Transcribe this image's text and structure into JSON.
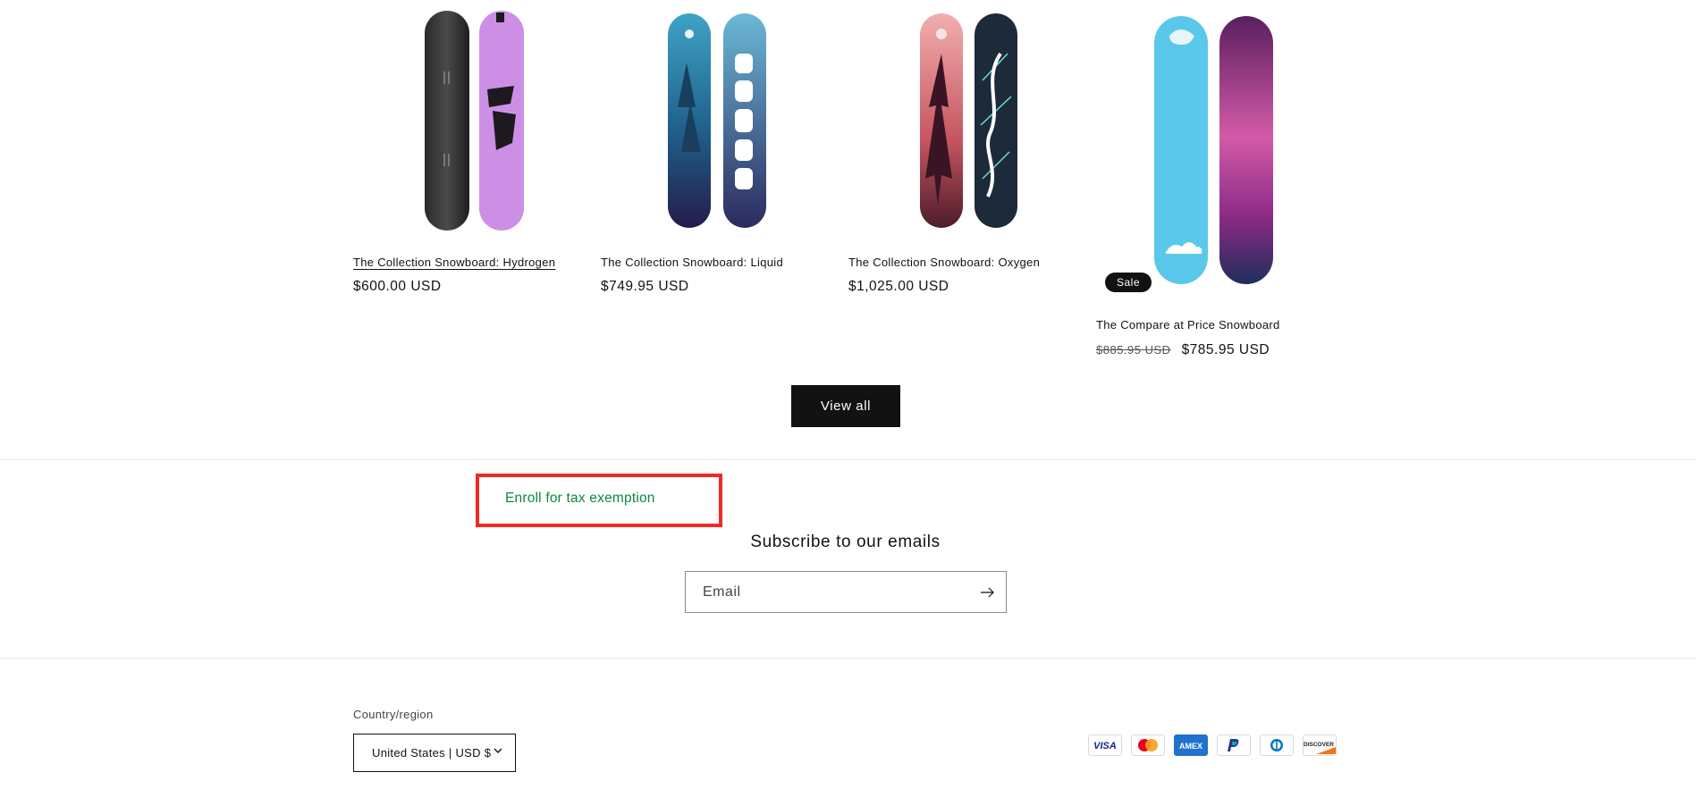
{
  "products": [
    {
      "title": "The Collection Snowboard: Hydrogen",
      "price": "$600.00 USD",
      "underlined": true
    },
    {
      "title": "The Collection Snowboard: Liquid",
      "price": "$749.95 USD"
    },
    {
      "title": "The Collection Snowboard: Oxygen",
      "price": "$1,025.00 USD"
    },
    {
      "title": "The Compare at Price Snowboard",
      "compare_price": "$885.95 USD",
      "price": "$785.95 USD",
      "badge": "Sale"
    }
  ],
  "view_all_label": "View all",
  "tax_exemption_link": "Enroll for tax exemption",
  "newsletter": {
    "title": "Subscribe to our emails",
    "placeholder": "Email",
    "submit_icon": "arrow-right-icon"
  },
  "footer": {
    "country_label": "Country/region",
    "country_value": "United States | USD $",
    "payment_methods": [
      "visa",
      "mastercard",
      "american-express",
      "paypal",
      "diners-club",
      "discover"
    ]
  },
  "colors": {
    "text": "#121212",
    "button_bg": "#121212",
    "link_green": "#0b8a3b",
    "highlight_red": "#ee2a24"
  }
}
